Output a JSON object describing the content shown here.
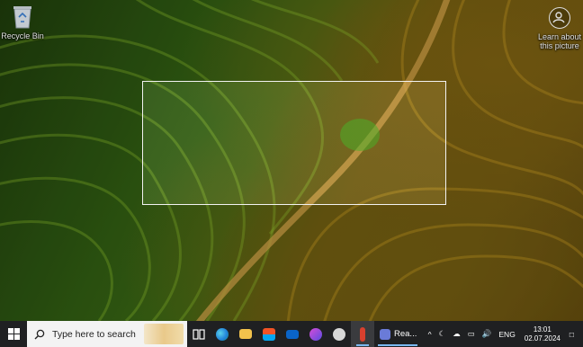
{
  "desktop": {
    "icons": [
      {
        "label": "Recycle Bin",
        "icon": "recycle-bin-icon"
      },
      {
        "label": "Learn about this picture",
        "icon": "camera-icon"
      }
    ]
  },
  "taskbar": {
    "search_placeholder": "Type here to search",
    "pinned": [
      {
        "name": "task-view",
        "icon": "task-view-icon"
      },
      {
        "name": "edge",
        "icon": "edge-icon"
      },
      {
        "name": "file-explorer",
        "icon": "folder-icon"
      },
      {
        "name": "store",
        "icon": "store-icon"
      },
      {
        "name": "mail",
        "icon": "mail-icon"
      },
      {
        "name": "media",
        "icon": "media-player-icon"
      },
      {
        "name": "app-bird",
        "icon": "bird-icon"
      },
      {
        "name": "app-red",
        "icon": "red-app-icon"
      }
    ],
    "running_app": {
      "label": "Rea...",
      "icon": "reader-icon"
    },
    "tray": {
      "language": "ENG",
      "time": "13:01",
      "date": "02.07.2024"
    }
  },
  "colors": {
    "taskbar_bg": "#1f2022",
    "search_bg": "#f3f3f3",
    "active_underline": "#7ab8f0"
  }
}
